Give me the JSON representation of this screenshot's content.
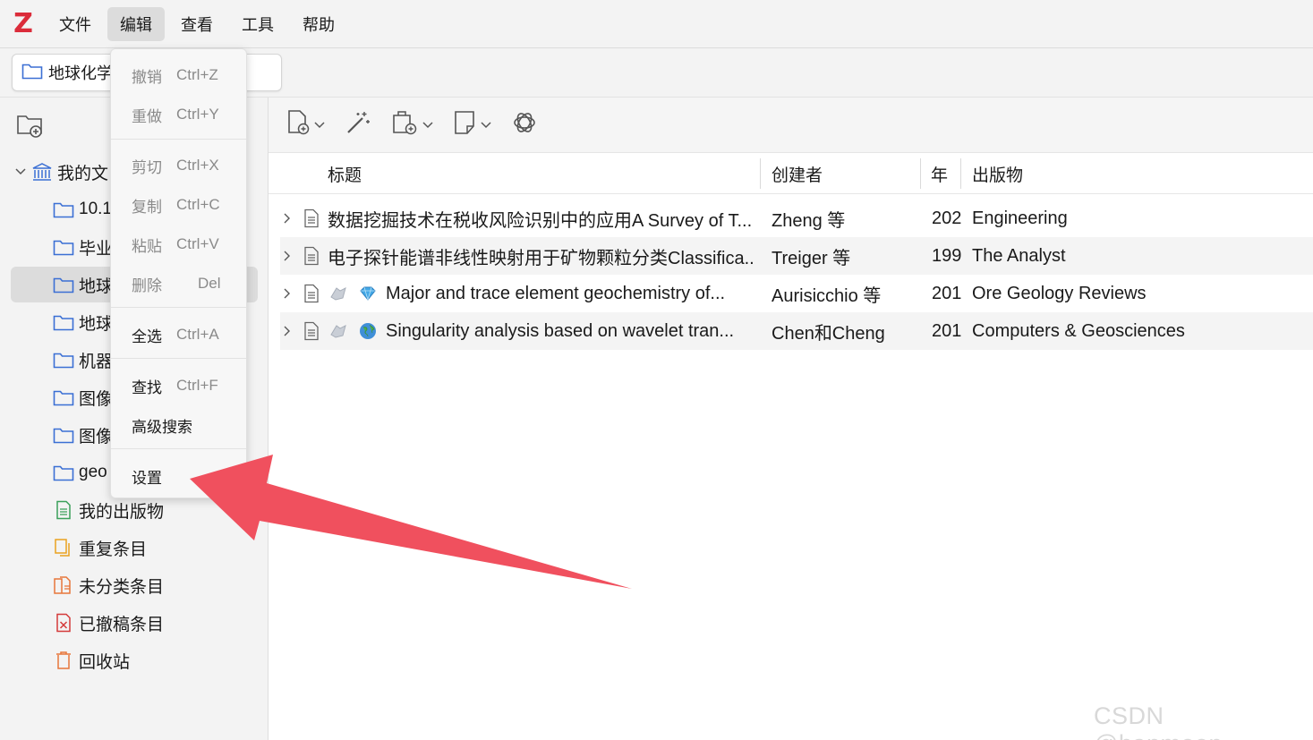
{
  "app": {
    "logo": "Z"
  },
  "menubar": {
    "items": [
      "文件",
      "编辑",
      "查看",
      "工具",
      "帮助"
    ],
    "active": "编辑"
  },
  "tab": {
    "label": "地球化学"
  },
  "sidebar": {
    "new_collection_icon": "new-collection-icon",
    "library": {
      "label": "我的文"
    },
    "collections": [
      {
        "label": "10.1"
      },
      {
        "label": "毕业"
      },
      {
        "label": "地球"
      },
      {
        "label": "地球"
      },
      {
        "label": "机器"
      },
      {
        "label": "图像"
      },
      {
        "label": "图像"
      },
      {
        "label": "geo"
      }
    ],
    "special": [
      {
        "label": "我的出版物",
        "icon": "my-publications-icon"
      },
      {
        "label": "重复条目",
        "icon": "duplicate-items-icon"
      },
      {
        "label": "未分类条目",
        "icon": "unfiled-items-icon"
      },
      {
        "label": "已撤稿条目",
        "icon": "retracted-items-icon"
      },
      {
        "label": "回收站",
        "icon": "trash-icon"
      }
    ]
  },
  "table": {
    "columns": [
      "标题",
      "创建者",
      "年",
      "出版物"
    ],
    "rows": [
      {
        "title": "数据挖掘技术在税收风险识别中的应用A Survey of T...",
        "creator": "Zheng 等",
        "year": "202",
        "publication": "Engineering"
      },
      {
        "title": "电子探针能谱非线性映射用于矿物颗粒分类Classifica...",
        "creator": "Treiger 等",
        "year": "199",
        "publication": "The Analyst"
      },
      {
        "title": "Major and trace element geochemistry of...",
        "creator": "Aurisicchio 等",
        "year": "201",
        "publication": "Ore Geology Reviews"
      },
      {
        "title": "Singularity analysis based on wavelet tran...",
        "creator": "Chen和Cheng",
        "year": "201",
        "publication": "Computers & Geosciences"
      }
    ]
  },
  "edit_menu": {
    "undo": {
      "label": "撤销",
      "shortcut": "Ctrl+Z"
    },
    "redo": {
      "label": "重做",
      "shortcut": "Ctrl+Y"
    },
    "cut": {
      "label": "剪切",
      "shortcut": "Ctrl+X"
    },
    "copy": {
      "label": "复制",
      "shortcut": "Ctrl+C"
    },
    "paste": {
      "label": "粘贴",
      "shortcut": "Ctrl+V"
    },
    "delete": {
      "label": "删除",
      "shortcut": "Del"
    },
    "select_all": {
      "label": "全选",
      "shortcut": "Ctrl+A"
    },
    "find": {
      "label": "查找",
      "shortcut": "Ctrl+F"
    },
    "advanced_search": {
      "label": "高级搜索"
    },
    "settings": {
      "label": "设置"
    }
  },
  "colors": {
    "brand": "#db2c3a",
    "annotation_arrow": "#f0505e",
    "folder": "#3b6fd4"
  },
  "watermark": "CSDN @hanmoon_"
}
